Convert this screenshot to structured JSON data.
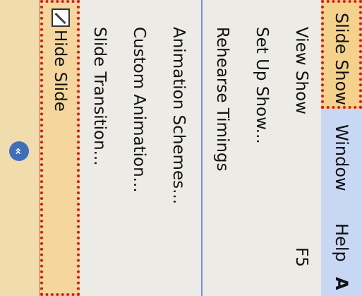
{
  "menubar": {
    "slide_show": "Slide Show",
    "window": "Window",
    "help": "Help",
    "extra": "A"
  },
  "menu": {
    "view_show": "View Show",
    "view_show_shortcut": "F5",
    "set_up_show": "Set Up Show...",
    "rehearse_timings": "Rehearse Timings",
    "animation_schemes": "Animation Schemes...",
    "custom_animation": "Custom Animation...",
    "slide_transition": "Slide Transition...",
    "hide_slide": "Hide Slide"
  },
  "collapse": {
    "glyph": "«"
  },
  "icons": [
    "view-show-icon",
    "set-up-show-icon",
    "rehearse-icon",
    "animation-schemes-icon",
    "custom-animation-icon",
    "slide-transition-icon"
  ],
  "colors": {
    "highlight_border": "#e01818",
    "menubar": "#c8d8f4",
    "selected_bg": "#f4d28c",
    "collapse_bg": "#f1dcae",
    "chevron": "#3f6fb8"
  }
}
